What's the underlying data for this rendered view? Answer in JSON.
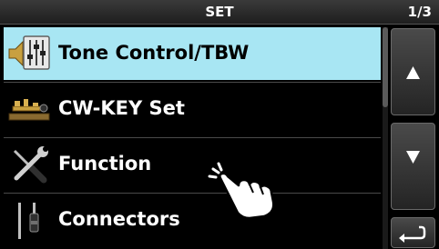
{
  "header": {
    "title": "SET",
    "page_indicator": "1/3"
  },
  "menu": {
    "items": [
      {
        "label": "Tone Control/TBW",
        "icon": "tone-control-icon",
        "selected": true
      },
      {
        "label": "CW-KEY Set",
        "icon": "cw-key-icon",
        "selected": false
      },
      {
        "label": "Function",
        "icon": "tools-icon",
        "selected": false
      },
      {
        "label": "Connectors",
        "icon": "connector-plug-icon",
        "selected": false
      }
    ]
  },
  "controls": {
    "up_icon": "triangle-up-icon",
    "down_icon": "triangle-down-icon",
    "back_icon": "return-arrow-icon"
  },
  "scroll": {
    "position_fraction": 0.0,
    "visible_fraction": 0.36
  },
  "colors": {
    "selected_row": "#a8e6f3",
    "background": "#000000",
    "text": "#ffffff"
  }
}
